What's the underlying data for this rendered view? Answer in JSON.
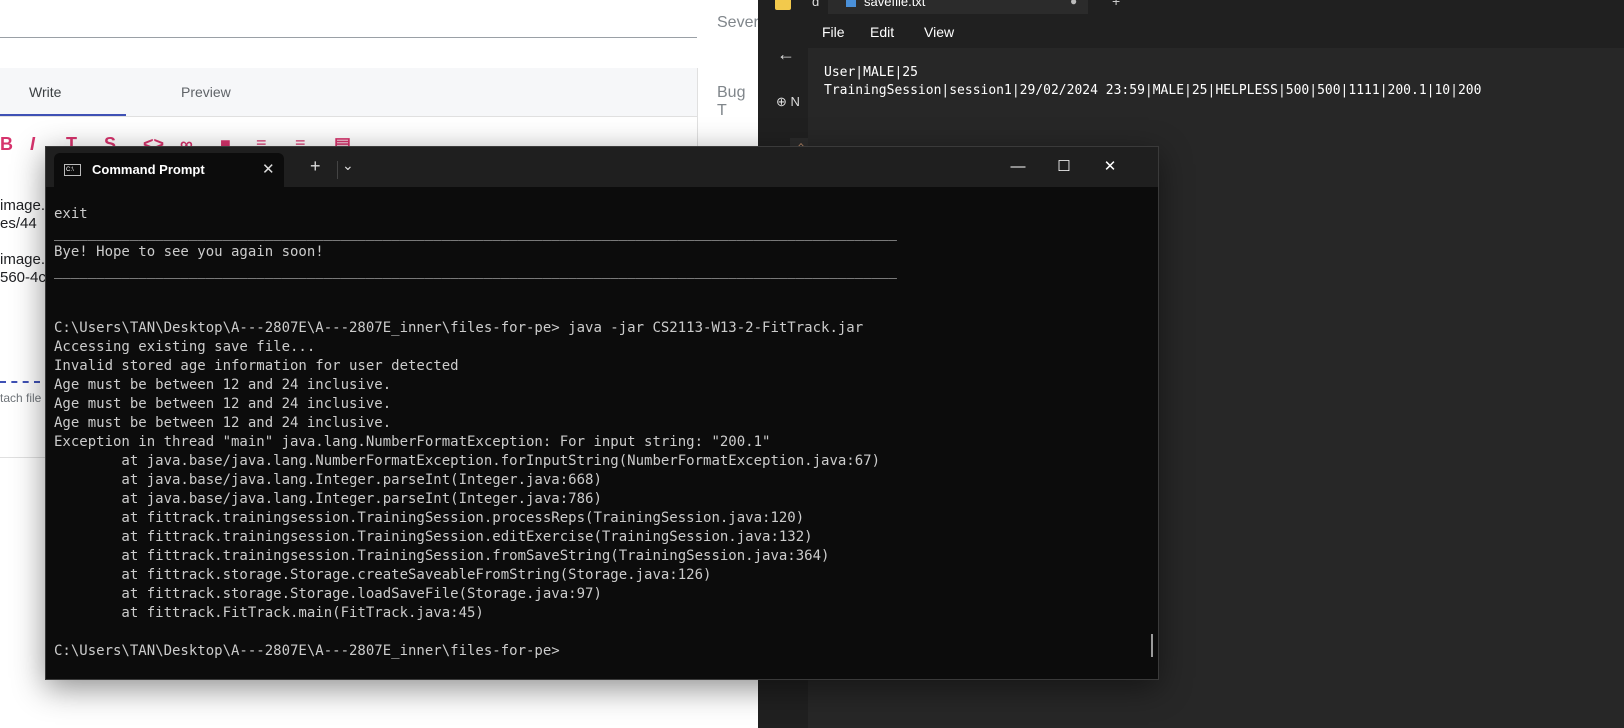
{
  "browser": {
    "side_labels": [
      "Sever",
      "Bug T"
    ],
    "tabs": {
      "write": "Write",
      "preview": "Preview"
    },
    "snippets": [
      "image.",
      "es/44",
      "image.",
      "560-4c"
    ],
    "attach_text": "tach file"
  },
  "notepad": {
    "folder_tab_text": "d",
    "file_tab_title": "savefile.txt",
    "rail_new_label": "N",
    "menu": [
      "File",
      "Edit",
      "View"
    ],
    "lines": [
      "User|MALE|25",
      "TrainingSession|session1|29/02/2024 23:59|MALE|25|HELPLESS|500|500|1111|200.1|10|200"
    ]
  },
  "terminal": {
    "tab_title": "Command Prompt",
    "lines": [
      "exit",
      "____________________________________________________________________________________________________",
      "Bye! Hope to see you again soon!",
      "____________________________________________________________________________________________________",
      "",
      "",
      "C:\\Users\\TAN\\Desktop\\A---2807E\\A---2807E_inner\\files-for-pe> java -jar CS2113-W13-2-FitTrack.jar",
      "Accessing existing save file...",
      "Invalid stored age information for user detected",
      "Age must be between 12 and 24 inclusive.",
      "Age must be between 12 and 24 inclusive.",
      "Age must be between 12 and 24 inclusive.",
      "Exception in thread \"main\" java.lang.NumberFormatException: For input string: \"200.1\"",
      "        at java.base/java.lang.NumberFormatException.forInputString(NumberFormatException.java:67)",
      "        at java.base/java.lang.Integer.parseInt(Integer.java:668)",
      "        at java.base/java.lang.Integer.parseInt(Integer.java:786)",
      "        at fittrack.trainingsession.TrainingSession.processReps(TrainingSession.java:120)",
      "        at fittrack.trainingsession.TrainingSession.editExercise(TrainingSession.java:132)",
      "        at fittrack.trainingsession.TrainingSession.fromSaveString(TrainingSession.java:364)",
      "        at fittrack.storage.Storage.createSaveableFromString(Storage.java:126)",
      "        at fittrack.storage.Storage.loadSaveFile(Storage.java:97)",
      "        at fittrack.FitTrack.main(FitTrack.java:45)",
      "",
      "C:\\Users\\TAN\\Desktop\\A---2807E\\A---2807E_inner\\files-for-pe>"
    ]
  }
}
